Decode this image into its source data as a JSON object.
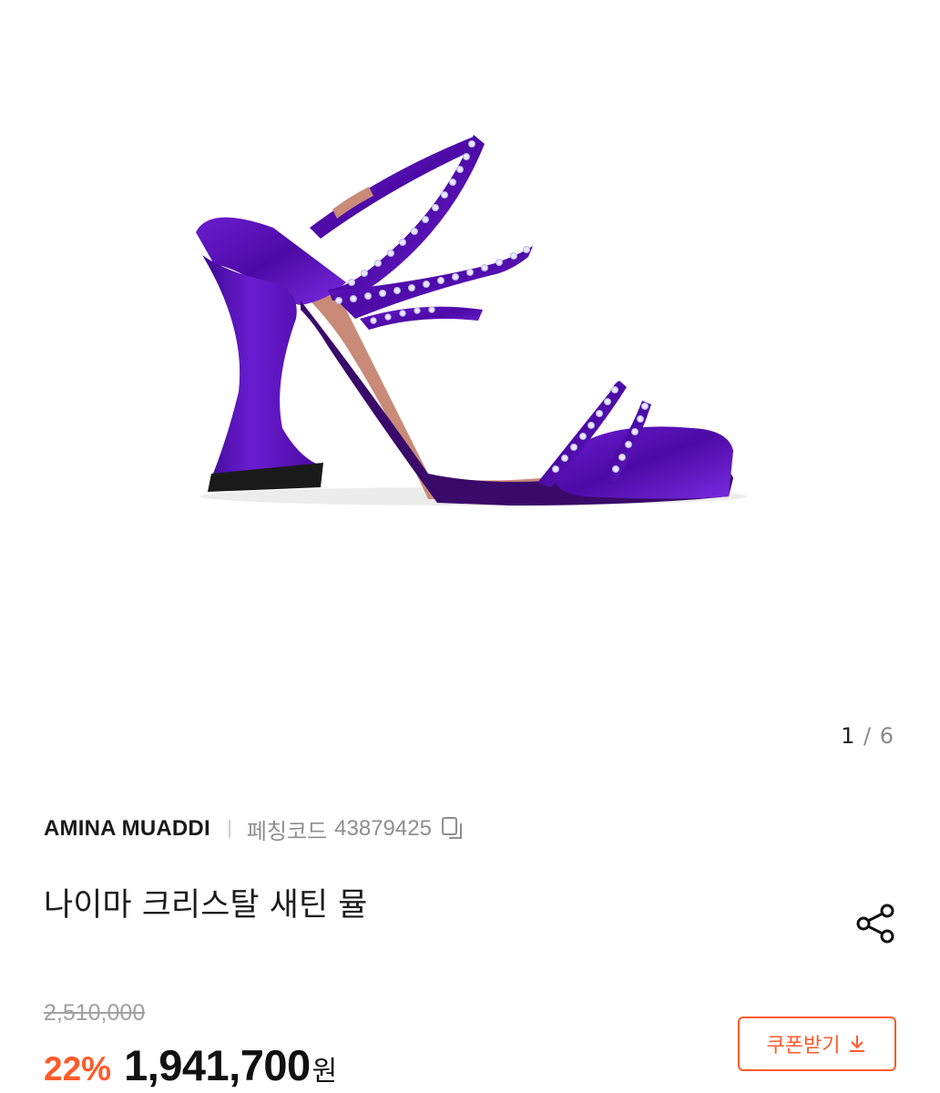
{
  "gallery": {
    "current": "1",
    "separator": "/",
    "total": "6",
    "image_alt": "purple satin crystal strap heeled mule"
  },
  "product": {
    "brand": "AMINA MUADDI",
    "code_label": "페칭코드",
    "code_value": "43879425",
    "title": "나이마 크리스탈 새틴 뮬"
  },
  "pricing": {
    "original_price": "2,510,000",
    "discount": "22%",
    "price": "1,941,700",
    "currency": "원"
  },
  "actions": {
    "coupon_label": "쿠폰받기"
  },
  "colors": {
    "accent": "#ff5a2a",
    "product_purple": "#5b12b8"
  }
}
